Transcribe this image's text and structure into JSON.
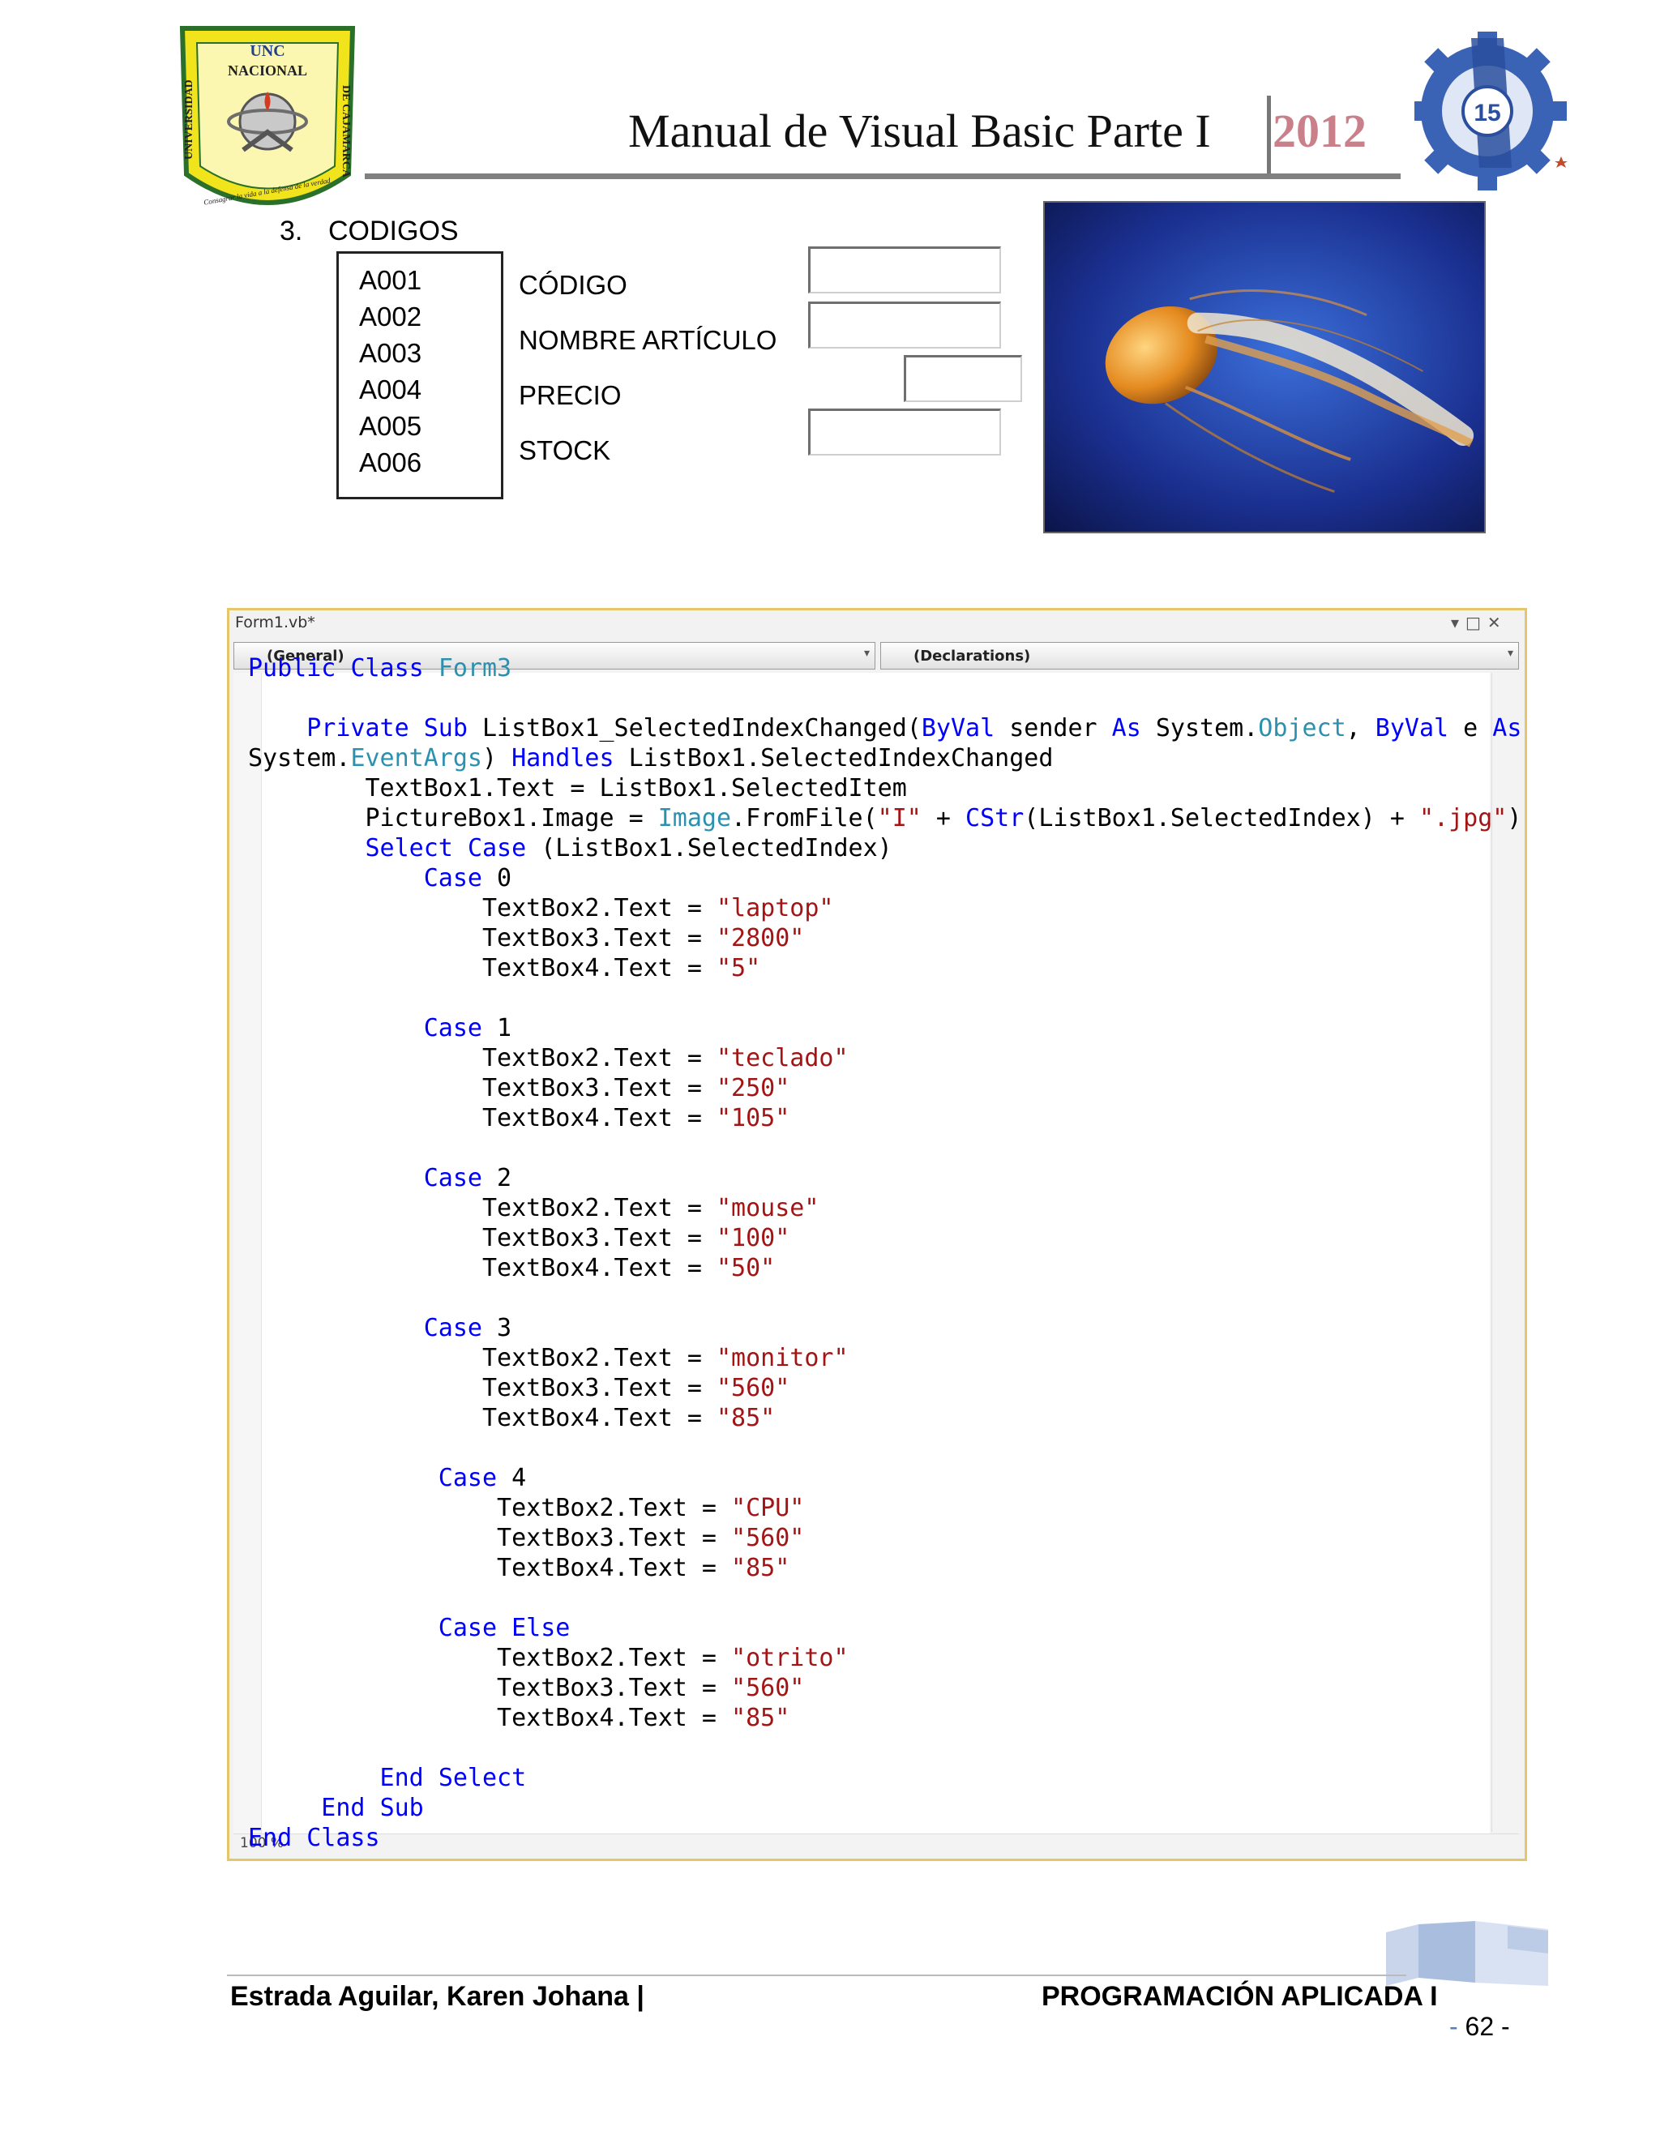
{
  "header": {
    "title": "Manual de Visual Basic Parte I",
    "year": "2012",
    "left_logo": {
      "line1": "UNC",
      "line2": "NACIONAL",
      "left_side": "UNIVERSIDAD",
      "right_side": "DE CAJAMARCA",
      "motto": "Consagrar la vida a la defensa de la verdad"
    },
    "right_logo": {
      "text": "15"
    }
  },
  "section": {
    "number": "3.",
    "title": "CODIGOS"
  },
  "form": {
    "listbox_items": [
      "A001",
      "A002",
      "A003",
      "A004",
      "A005",
      "A006"
    ],
    "labels": {
      "codigo": "CÓDIGO",
      "nombre": "NOMBRE ARTÍCULO",
      "precio": "PRECIO",
      "stock": "STOCK"
    },
    "textboxes": {
      "codigo": "",
      "nombre": "",
      "precio": "",
      "stock": ""
    }
  },
  "code_window": {
    "title": "Form1.vb*",
    "left_dropdown": "(General)",
    "right_dropdown": "(Declarations)",
    "zoom": "100 %",
    "lines": [
      [
        {
          "t": "Public ",
          "c": "kw"
        },
        {
          "t": "Class ",
          "c": "kw"
        },
        {
          "t": "Form3",
          "c": "ty"
        }
      ],
      [],
      [
        {
          "t": "    Private ",
          "c": "kw"
        },
        {
          "t": "Sub ",
          "c": "kw"
        },
        {
          "t": "ListBox1_SelectedIndexChanged(",
          "c": ""
        },
        {
          "t": "ByVal",
          "c": "kw"
        },
        {
          "t": " sender ",
          "c": ""
        },
        {
          "t": "As",
          "c": "kw"
        },
        {
          "t": " System.",
          "c": ""
        },
        {
          "t": "Object",
          "c": "ty"
        },
        {
          "t": ", ",
          "c": ""
        },
        {
          "t": "ByVal",
          "c": "kw"
        },
        {
          "t": " e ",
          "c": ""
        },
        {
          "t": "As",
          "c": "kw"
        }
      ],
      [
        {
          "t": "System.",
          "c": ""
        },
        {
          "t": "EventArgs",
          "c": "ty"
        },
        {
          "t": ") ",
          "c": ""
        },
        {
          "t": "Handles",
          "c": "kw"
        },
        {
          "t": " ListBox1.SelectedIndexChanged",
          "c": ""
        }
      ],
      [
        {
          "t": "        TextBox1.Text = ListBox1.SelectedItem",
          "c": ""
        }
      ],
      [
        {
          "t": "        PictureBox1.Image = ",
          "c": ""
        },
        {
          "t": "Image",
          "c": "ty"
        },
        {
          "t": ".FromFile(",
          "c": ""
        },
        {
          "t": "\"I\"",
          "c": "st"
        },
        {
          "t": " + ",
          "c": ""
        },
        {
          "t": "CStr",
          "c": "kw"
        },
        {
          "t": "(ListBox1.SelectedIndex) + ",
          "c": ""
        },
        {
          "t": "\".jpg\"",
          "c": "st"
        },
        {
          "t": ")",
          "c": ""
        }
      ],
      [
        {
          "t": "        Select ",
          "c": "kw"
        },
        {
          "t": "Case",
          "c": "kw"
        },
        {
          "t": " (ListBox1.SelectedIndex)",
          "c": ""
        }
      ],
      [
        {
          "t": "            Case",
          "c": "kw"
        },
        {
          "t": " 0",
          "c": ""
        }
      ],
      [
        {
          "t": "                TextBox2.Text = ",
          "c": ""
        },
        {
          "t": "\"laptop\"",
          "c": "st"
        }
      ],
      [
        {
          "t": "                TextBox3.Text = ",
          "c": ""
        },
        {
          "t": "\"2800\"",
          "c": "st"
        }
      ],
      [
        {
          "t": "                TextBox4.Text = ",
          "c": ""
        },
        {
          "t": "\"5\"",
          "c": "st"
        }
      ],
      [],
      [
        {
          "t": "            Case",
          "c": "kw"
        },
        {
          "t": " 1",
          "c": ""
        }
      ],
      [
        {
          "t": "                TextBox2.Text = ",
          "c": ""
        },
        {
          "t": "\"teclado\"",
          "c": "st"
        }
      ],
      [
        {
          "t": "                TextBox3.Text = ",
          "c": ""
        },
        {
          "t": "\"250\"",
          "c": "st"
        }
      ],
      [
        {
          "t": "                TextBox4.Text = ",
          "c": ""
        },
        {
          "t": "\"105\"",
          "c": "st"
        }
      ],
      [],
      [
        {
          "t": "            Case",
          "c": "kw"
        },
        {
          "t": " 2",
          "c": ""
        }
      ],
      [
        {
          "t": "                TextBox2.Text = ",
          "c": ""
        },
        {
          "t": "\"mouse\"",
          "c": "st"
        }
      ],
      [
        {
          "t": "                TextBox3.Text = ",
          "c": ""
        },
        {
          "t": "\"100\"",
          "c": "st"
        }
      ],
      [
        {
          "t": "                TextBox4.Text = ",
          "c": ""
        },
        {
          "t": "\"50\"",
          "c": "st"
        }
      ],
      [],
      [
        {
          "t": "            Case",
          "c": "kw"
        },
        {
          "t": " 3",
          "c": ""
        }
      ],
      [
        {
          "t": "                TextBox2.Text = ",
          "c": ""
        },
        {
          "t": "\"monitor\"",
          "c": "st"
        }
      ],
      [
        {
          "t": "                TextBox3.Text = ",
          "c": ""
        },
        {
          "t": "\"560\"",
          "c": "st"
        }
      ],
      [
        {
          "t": "                TextBox4.Text = ",
          "c": ""
        },
        {
          "t": "\"85\"",
          "c": "st"
        }
      ],
      [],
      [
        {
          "t": "             Case",
          "c": "kw"
        },
        {
          "t": " 4",
          "c": ""
        }
      ],
      [
        {
          "t": "                 TextBox2.Text = ",
          "c": ""
        },
        {
          "t": "\"CPU\"",
          "c": "st"
        }
      ],
      [
        {
          "t": "                 TextBox3.Text = ",
          "c": ""
        },
        {
          "t": "\"560\"",
          "c": "st"
        }
      ],
      [
        {
          "t": "                 TextBox4.Text = ",
          "c": ""
        },
        {
          "t": "\"85\"",
          "c": "st"
        }
      ],
      [],
      [
        {
          "t": "             Case ",
          "c": "kw"
        },
        {
          "t": "Else",
          "c": "kw"
        }
      ],
      [
        {
          "t": "                 TextBox2.Text = ",
          "c": ""
        },
        {
          "t": "\"otrito\"",
          "c": "st"
        }
      ],
      [
        {
          "t": "                 TextBox3.Text = ",
          "c": ""
        },
        {
          "t": "\"560\"",
          "c": "st"
        }
      ],
      [
        {
          "t": "                 TextBox4.Text = ",
          "c": ""
        },
        {
          "t": "\"85\"",
          "c": "st"
        }
      ],
      [],
      [
        {
          "t": "         End ",
          "c": "kw"
        },
        {
          "t": "Select",
          "c": "kw"
        }
      ],
      [
        {
          "t": "     End ",
          "c": "kw"
        },
        {
          "t": "Sub",
          "c": "kw"
        }
      ],
      [
        {
          "t": "End ",
          "c": "kw"
        },
        {
          "t": "Class",
          "c": "kw"
        }
      ]
    ]
  },
  "footer": {
    "author": "Estrada Aguilar, Karen Johana |",
    "course": "PROGRAMACIÓN APLICADA I",
    "page": "62"
  },
  "colors": {
    "keyword": "#0000ff",
    "type": "#2b91af",
    "string": "#a31515",
    "year": "#c9808a",
    "window_border": "#e6c66a"
  }
}
